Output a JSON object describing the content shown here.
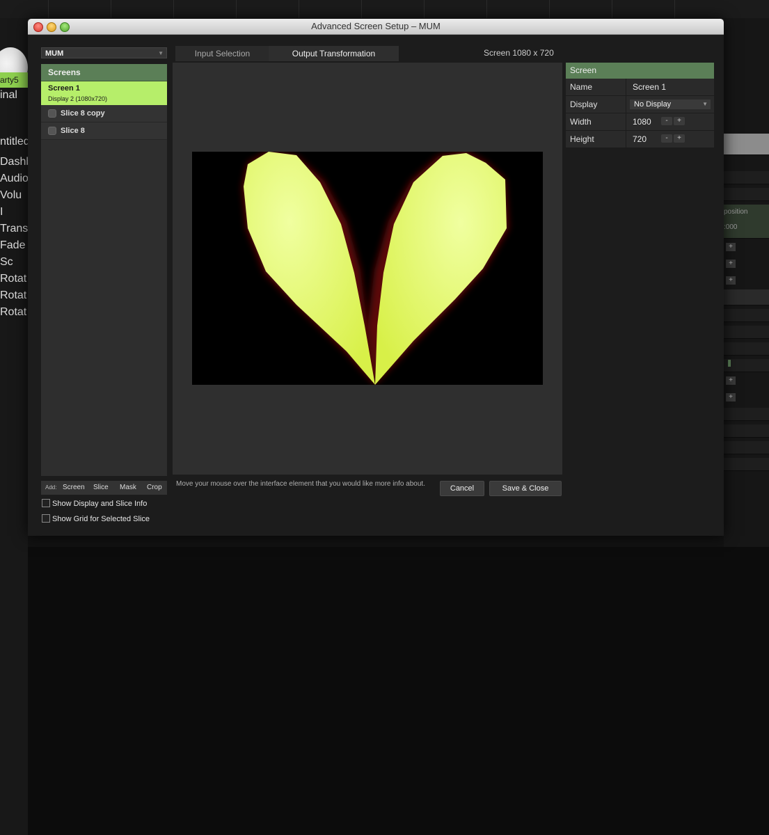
{
  "window": {
    "title": "Advanced Screen Setup – MUM"
  },
  "background_app": {
    "left_labels": [
      "arty5",
      "inal",
      "ntitled",
      "Dashboa",
      "Audio",
      "Volu",
      "I",
      "Transfor",
      "Fade",
      "Sc",
      "Rotat",
      "Rotat",
      "Rotat"
    ],
    "right_labels": [
      "position",
      ":000"
    ]
  },
  "preset": {
    "value": "MUM"
  },
  "screens": {
    "header": "Screens",
    "items": [
      {
        "name": "Screen 1",
        "subtitle": "Display 2 (1080x720)"
      }
    ],
    "slices": [
      {
        "name": "Slice 8 copy"
      },
      {
        "name": "Slice 8"
      }
    ]
  },
  "add_bar": {
    "label": "Add:",
    "buttons": [
      "Screen",
      "Slice",
      "Mask",
      "Crop"
    ]
  },
  "options": {
    "show_display_info": "Show Display and Slice Info",
    "show_grid": "Show Grid for Selected Slice"
  },
  "tabs": [
    {
      "label": "Input Selection",
      "active": false
    },
    {
      "label": "Output Transformation",
      "active": true
    }
  ],
  "screen_size": "Screen  1080 x 720",
  "info_text": "Move your mouse over the interface element that you would like more info about.",
  "buttons": {
    "cancel": "Cancel",
    "save": "Save & Close"
  },
  "properties": {
    "header": "Screen",
    "rows": {
      "name": {
        "label": "Name",
        "value": "Screen 1"
      },
      "display": {
        "label": "Display",
        "value": "No Display"
      },
      "width": {
        "label": "Width",
        "value": "1080"
      },
      "height": {
        "label": "Height",
        "value": "720"
      }
    },
    "stepper_minus": "-",
    "stepper_plus": "+"
  },
  "colors": {
    "accent_green": "#b6ee6a",
    "header_green": "#5b7f57",
    "leaf_color": "#e6ff70"
  }
}
